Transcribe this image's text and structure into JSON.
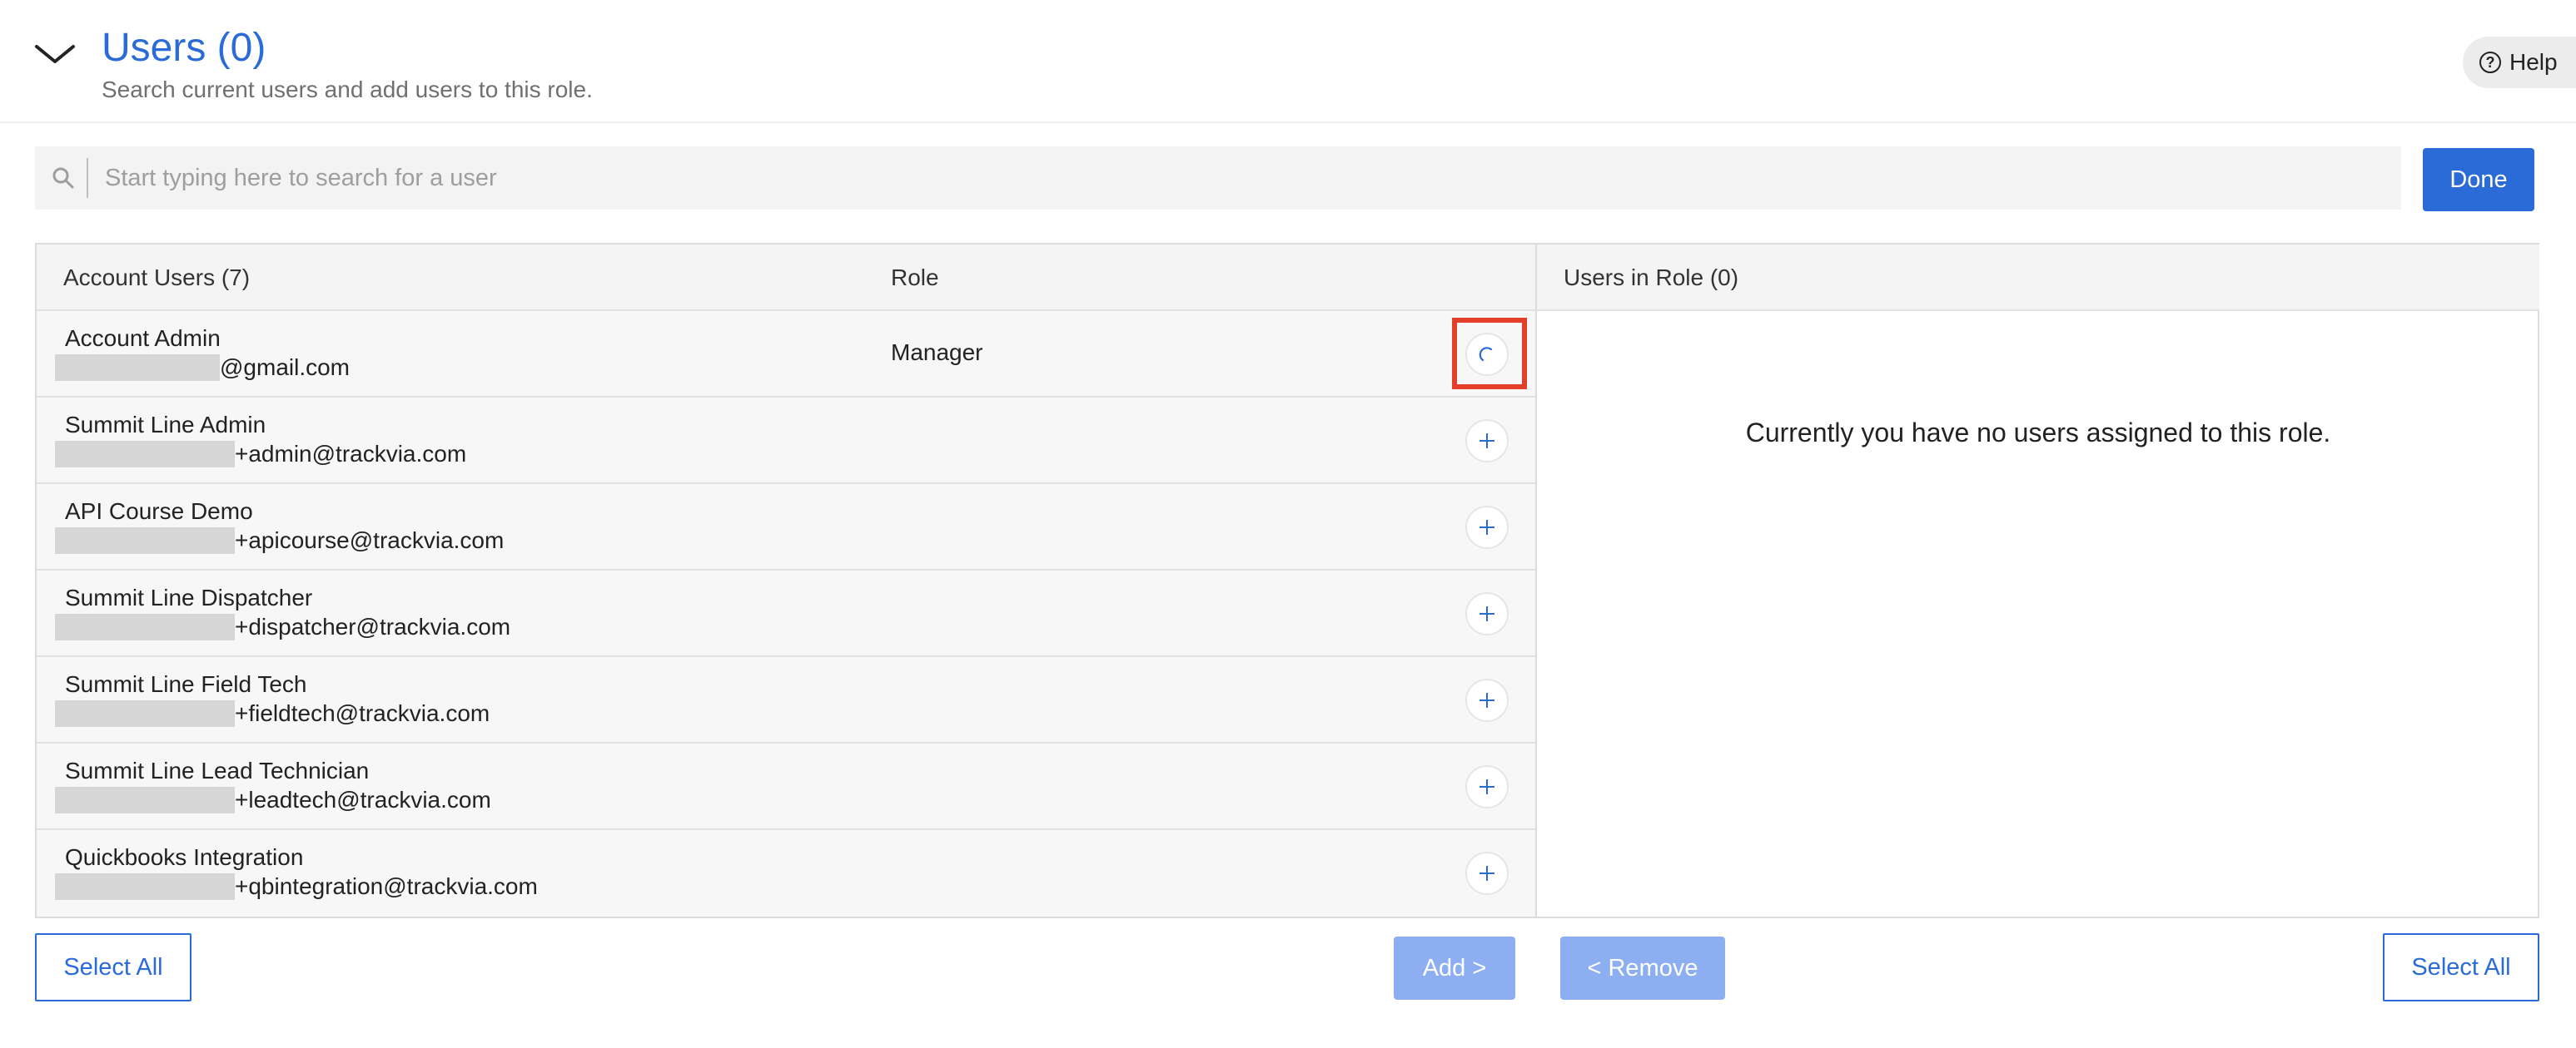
{
  "header": {
    "title": "Users (0)",
    "subtitle": "Search current users and add users to this role.",
    "help_label": "Help"
  },
  "search": {
    "placeholder": "Start typing here to search for a user",
    "value": ""
  },
  "done_label": "Done",
  "account_users": {
    "column_name": "Account Users (7)",
    "column_role": "Role",
    "rows": [
      {
        "name": "Account Admin",
        "email_suffix": "@gmail.com",
        "role": "Manager",
        "action_icon": "loading-spinner-icon"
      },
      {
        "name": "Summit Line Admin",
        "email_suffix": "+admin@trackvia.com",
        "role": "",
        "action_icon": "plus-icon"
      },
      {
        "name": "API Course Demo",
        "email_suffix": "+apicourse@trackvia.com",
        "role": "",
        "action_icon": "plus-icon"
      },
      {
        "name": "Summit Line Dispatcher",
        "email_suffix": "+dispatcher@trackvia.com",
        "role": "",
        "action_icon": "plus-icon"
      },
      {
        "name": "Summit Line Field Tech",
        "email_suffix": "+fieldtech@trackvia.com",
        "role": "",
        "action_icon": "plus-icon"
      },
      {
        "name": "Summit Line Lead Technician",
        "email_suffix": "+leadtech@trackvia.com",
        "role": "",
        "action_icon": "plus-icon"
      },
      {
        "name": "Quickbooks Integration",
        "email_suffix": "+qbintegration@trackvia.com",
        "role": "",
        "action_icon": "plus-icon"
      }
    ]
  },
  "users_in_role": {
    "column_name": "Users in Role (0)",
    "empty_message": "Currently you have no users assigned to this role."
  },
  "footer": {
    "select_all_left": "Select All",
    "add_label": "Add >",
    "remove_label": "< Remove",
    "select_all_right": "Select All"
  },
  "colors": {
    "accent": "#2a6bd8",
    "disabled": "#8daef0",
    "highlight": "#e3402c"
  }
}
